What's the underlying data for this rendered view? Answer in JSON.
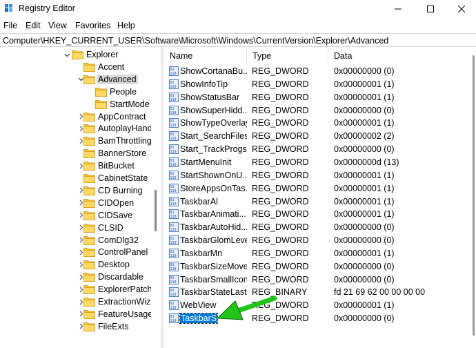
{
  "window": {
    "title": "Registry Editor",
    "icon": "registry-icon"
  },
  "menu": [
    "File",
    "Edit",
    "View",
    "Favorites",
    "Help"
  ],
  "address": "Computer\\HKEY_CURRENT_USER\\Software\\Microsoft\\Windows\\CurrentVersion\\Explorer\\Advanced",
  "tree": [
    {
      "label": "Explorer",
      "expanded": true,
      "chevron": "down"
    },
    {
      "label": "Accent",
      "chevron": "none"
    },
    {
      "label": "Advanced",
      "expanded": true,
      "chevron": "down",
      "selected": true
    },
    {
      "label": "People",
      "chevron": "none"
    },
    {
      "label": "StartMode",
      "chevron": "none"
    },
    {
      "label": "AppContract",
      "chevron": "right"
    },
    {
      "label": "AutoplayHand",
      "chevron": "right"
    },
    {
      "label": "BamThrottling",
      "chevron": "right"
    },
    {
      "label": "BannerStore",
      "chevron": "none"
    },
    {
      "label": "BitBucket",
      "chevron": "right"
    },
    {
      "label": "CabinetState",
      "chevron": "none"
    },
    {
      "label": "CD Burning",
      "chevron": "right"
    },
    {
      "label": "CIDOpen",
      "chevron": "right"
    },
    {
      "label": "CIDSave",
      "chevron": "right"
    },
    {
      "label": "CLSID",
      "chevron": "right"
    },
    {
      "label": "ComDlg32",
      "chevron": "right"
    },
    {
      "label": "ControlPanel",
      "chevron": "right"
    },
    {
      "label": "Desktop",
      "chevron": "right"
    },
    {
      "label": "Discardable",
      "chevron": "right"
    },
    {
      "label": "ExplorerPatche",
      "chevron": "right"
    },
    {
      "label": "ExtractionWiza",
      "chevron": "right"
    },
    {
      "label": "FeatureUsage",
      "chevron": "right"
    },
    {
      "label": "FileExts",
      "chevron": "right"
    }
  ],
  "columns": {
    "name": "Name",
    "type": "Type",
    "data": "Data"
  },
  "values": [
    {
      "name": "ShowCortanaBu...",
      "type": "REG_DWORD",
      "data": "0x00000000 (0)"
    },
    {
      "name": "ShowInfoTip",
      "type": "REG_DWORD",
      "data": "0x00000001 (1)"
    },
    {
      "name": "ShowStatusBar",
      "type": "REG_DWORD",
      "data": "0x00000001 (1)"
    },
    {
      "name": "ShowSuperHidd...",
      "type": "REG_DWORD",
      "data": "0x00000000 (0)"
    },
    {
      "name": "ShowTypeOverlay",
      "type": "REG_DWORD",
      "data": "0x00000001 (1)"
    },
    {
      "name": "Start_SearchFiles",
      "type": "REG_DWORD",
      "data": "0x00000002 (2)"
    },
    {
      "name": "Start_TrackProgs",
      "type": "REG_DWORD",
      "data": "0x00000000 (0)"
    },
    {
      "name": "StartMenuInit",
      "type": "REG_DWORD",
      "data": "0x0000000d (13)"
    },
    {
      "name": "StartShownOnU...",
      "type": "REG_DWORD",
      "data": "0x00000001 (1)"
    },
    {
      "name": "StoreAppsOnTas...",
      "type": "REG_DWORD",
      "data": "0x00000001 (1)"
    },
    {
      "name": "TaskbarAl",
      "type": "REG_DWORD",
      "data": "0x00000001 (1)"
    },
    {
      "name": "TaskbarAnimati...",
      "type": "REG_DWORD",
      "data": "0x00000001 (1)"
    },
    {
      "name": "TaskbarAutoHid...",
      "type": "REG_DWORD",
      "data": "0x00000000 (0)"
    },
    {
      "name": "TaskbarGlomLevel",
      "type": "REG_DWORD",
      "data": "0x00000000 (0)"
    },
    {
      "name": "TaskbarMn",
      "type": "REG_DWORD",
      "data": "0x00000001 (1)"
    },
    {
      "name": "TaskbarSizeMove",
      "type": "REG_DWORD",
      "data": "0x00000000 (0)"
    },
    {
      "name": "TaskbarSmallIcons",
      "type": "REG_DWORD",
      "data": "0x00000000 (0)"
    },
    {
      "name": "TaskbarStateLast...",
      "type": "REG_BINARY",
      "data": "fd 21 69 62 00 00 00 00"
    },
    {
      "name": "WebView",
      "type": "REG_DWORD",
      "data": "0x00000001 (1)"
    },
    {
      "name": "TaskbarSi",
      "type": "REG_DWORD",
      "data": "0x00000000 (0)",
      "selected": true,
      "editing": true
    }
  ],
  "annotation": {
    "color": "#22c41a",
    "icon": "pointer-arrow"
  }
}
